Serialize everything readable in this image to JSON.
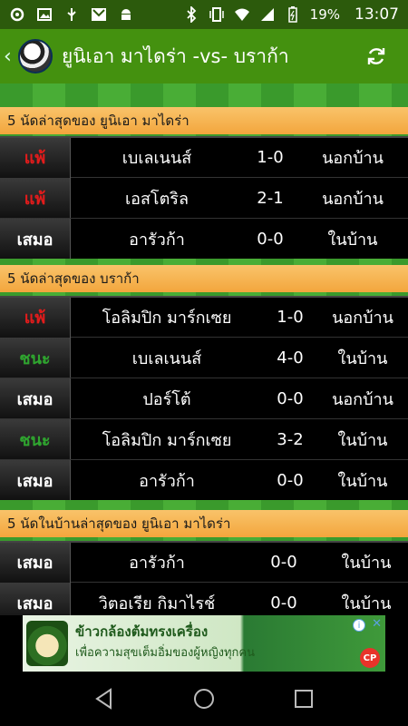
{
  "statusbar": {
    "battery": "19%",
    "time": "13:07"
  },
  "appbar": {
    "title": "ยูนิเอา มาไดร่า -vs- บราก้า"
  },
  "sections": [
    {
      "heading": "5 นัดล่าสุดของ ยูนิเอา มาไดร่า",
      "rows": [
        {
          "result": "แพ้",
          "kind": "lose",
          "team": "เบเลเนนส์",
          "score": "1-0",
          "venue": "นอกบ้าน"
        },
        {
          "result": "แพ้",
          "kind": "lose",
          "team": "เอสโตริล",
          "score": "2-1",
          "venue": "นอกบ้าน"
        },
        {
          "result": "เสมอ",
          "kind": "draw",
          "team": "อารัวก้า",
          "score": "0-0",
          "venue": "ในบ้าน"
        }
      ]
    },
    {
      "heading": "5 นัดล่าสุดของ บราก้า",
      "rows": [
        {
          "result": "แพ้",
          "kind": "lose",
          "team": "โอลิมปิก มาร์กเซย",
          "score": "1-0",
          "venue": "นอกบ้าน"
        },
        {
          "result": "ชนะ",
          "kind": "win",
          "team": "เบเลเนนส์",
          "score": "4-0",
          "venue": "ในบ้าน"
        },
        {
          "result": "เสมอ",
          "kind": "draw",
          "team": "ปอร์โต้",
          "score": "0-0",
          "venue": "นอกบ้าน"
        },
        {
          "result": "ชนะ",
          "kind": "win",
          "team": "โอลิมปิก มาร์กเซย",
          "score": "3-2",
          "venue": "ในบ้าน"
        },
        {
          "result": "เสมอ",
          "kind": "draw",
          "team": "อารัวก้า",
          "score": "0-0",
          "venue": "ในบ้าน"
        }
      ]
    },
    {
      "heading": "5 นัดในบ้านล่าสุดของ ยูนิเอา มาไดร่า",
      "rows": [
        {
          "result": "เสมอ",
          "kind": "draw",
          "team": "อารัวก้า",
          "score": "0-0",
          "venue": "ในบ้าน"
        },
        {
          "result": "เสมอ",
          "kind": "draw",
          "team": "วิตอเรีย กิมาไรช์",
          "score": "0-0",
          "venue": "ในบ้าน"
        }
      ]
    }
  ],
  "ad": {
    "line1": "ข้าวกล้องต้มทรงเครื่อง",
    "line2": "เพื่อความสุขเต็มอิ่มของผู้หญิงทุกคน",
    "badge": "CP"
  },
  "colors": {
    "appbar": "#44910f",
    "statusbar": "#2c5a0c",
    "lose": "#e21b1b",
    "win": "#2fa52f",
    "draw": "#ffffff",
    "section": "#f3a63d"
  }
}
